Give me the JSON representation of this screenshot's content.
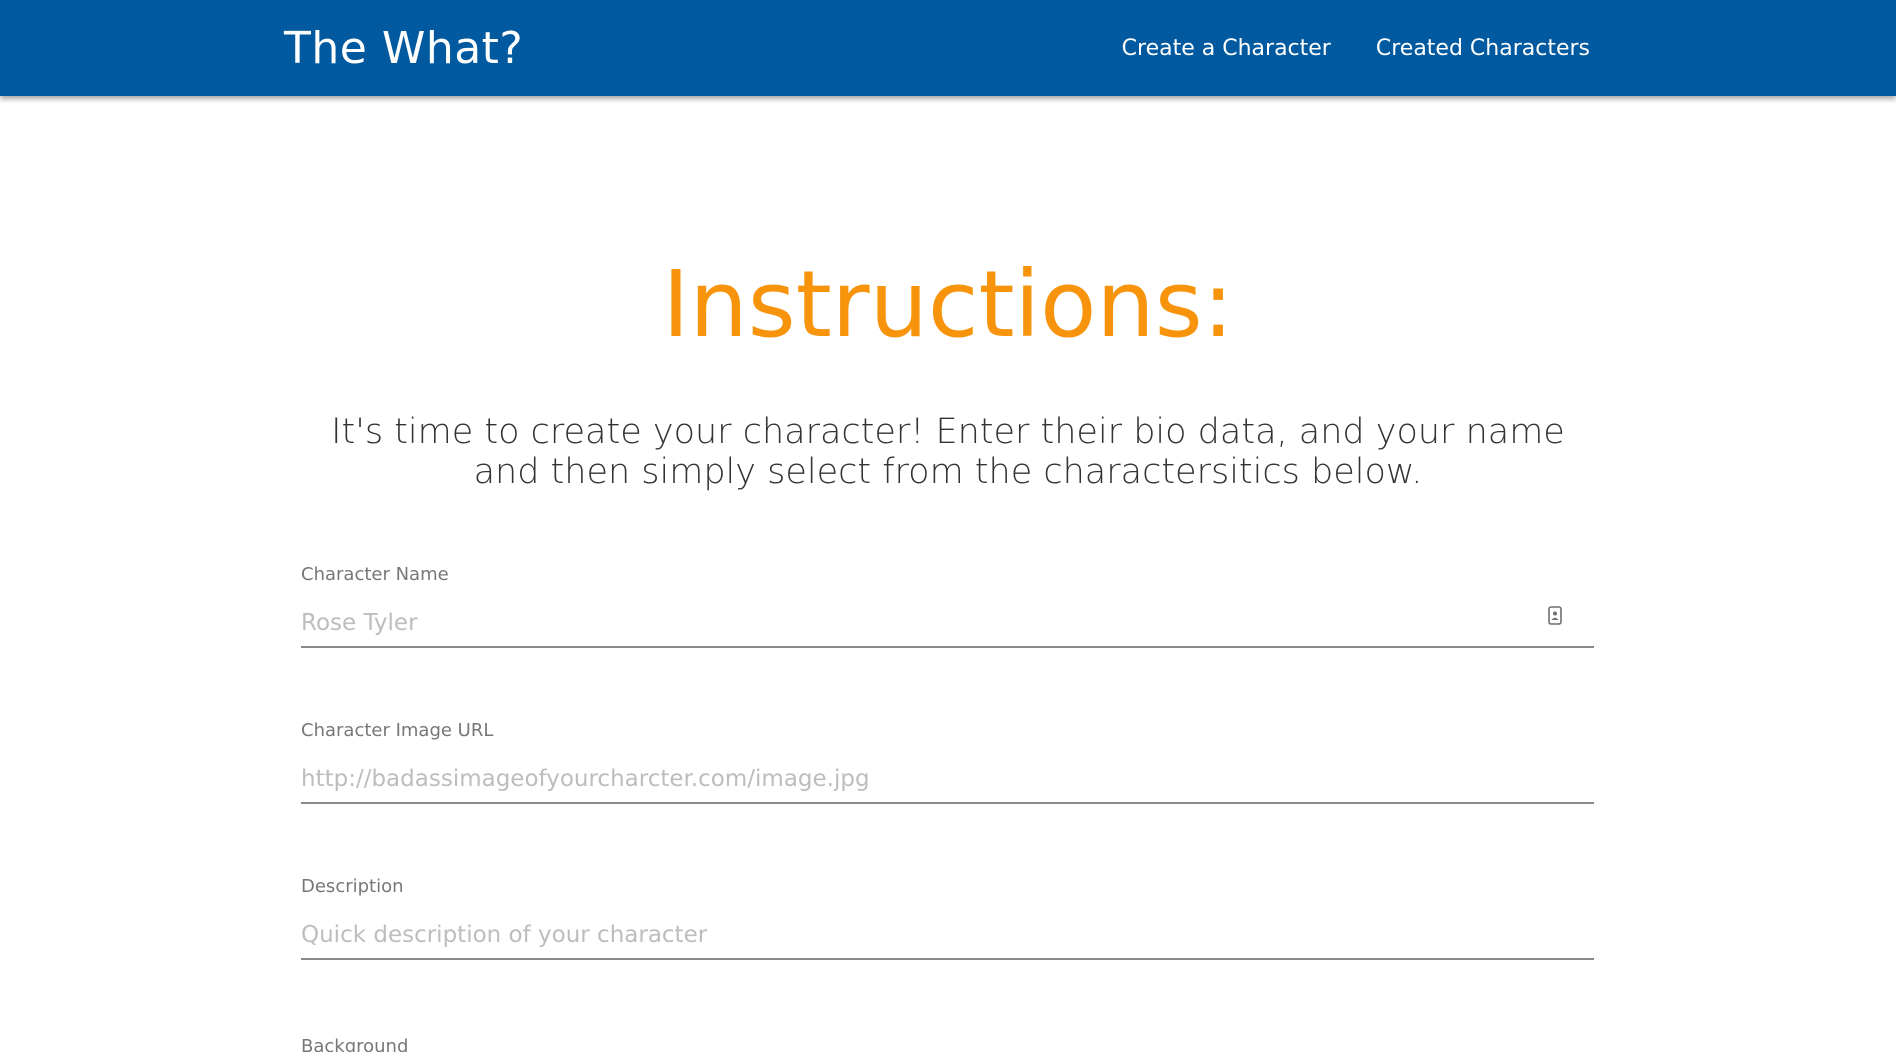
{
  "navbar": {
    "brand": "The What?",
    "links": [
      {
        "label": "Create a Character"
      },
      {
        "label": "Created Characters"
      }
    ],
    "background_color": "#015a9f"
  },
  "main": {
    "title": "Instructions:",
    "title_color": "#f7940c",
    "description": "It's time to create your character! Enter their bio data, and your name and then simply select from the charactersitics below."
  },
  "form": {
    "fields": [
      {
        "label": "Character Name",
        "placeholder": "Rose Tyler",
        "value": "",
        "icon": "contact-card-icon"
      },
      {
        "label": "Character Image URL",
        "placeholder": "http://badassimageofyourcharcter.com/image.jpg",
        "value": ""
      },
      {
        "label": "Description",
        "placeholder": "Quick description of your character",
        "value": ""
      },
      {
        "label": "Background"
      }
    ]
  }
}
